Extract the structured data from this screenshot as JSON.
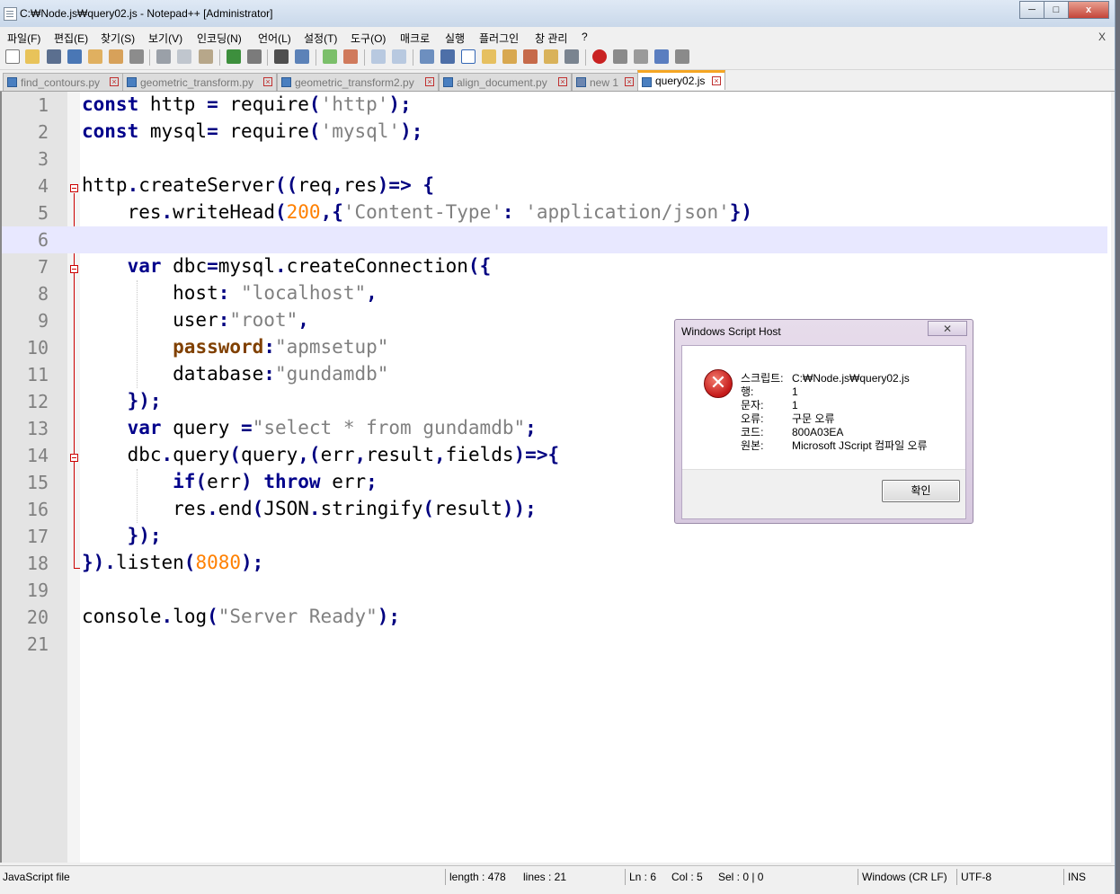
{
  "window": {
    "title": "C:₩Node.js₩query02.js - Notepad++ [Administrator]",
    "minimize": "─",
    "maximize": "□",
    "close": "x"
  },
  "menu": {
    "items": [
      "파일(F)",
      "편집(E)",
      "찾기(S)",
      "보기(V)",
      "인코딩(N)",
      "언어(L)",
      "설정(T)",
      "도구(O)",
      "매크로",
      "실행",
      "플러그인",
      "창 관리",
      "?"
    ],
    "close": "X"
  },
  "toolbar": {
    "icons": [
      "new-file-icon",
      "open-file-icon",
      "save-icon",
      "save-all-icon",
      "close-icon",
      "close-all-icon",
      "print-icon",
      "cut-icon",
      "copy-icon",
      "paste-icon",
      "undo-icon",
      "redo-icon",
      "find-icon",
      "replace-icon",
      "zoom-in-icon",
      "zoom-out-icon",
      "sync-v-icon",
      "sync-h-icon",
      "word-wrap-icon",
      "show-all-chars-icon",
      "indent-guide-icon",
      "udl-icon",
      "doc-map-icon",
      "function-list-icon",
      "folder-workspace-icon",
      "monitor-icon",
      "record-macro-icon",
      "stop-macro-icon",
      "play-macro-icon",
      "run-macro-multiple-icon",
      "save-macro-icon"
    ]
  },
  "tabs": [
    {
      "label": "find_contours.py",
      "active": false
    },
    {
      "label": "geometric_transform.py",
      "active": false
    },
    {
      "label": "geometric_transform2.py",
      "active": false
    },
    {
      "label": "align_document.py",
      "active": false
    },
    {
      "label": "new 1",
      "active": false
    },
    {
      "label": "query02.js",
      "active": true
    }
  ],
  "editor": {
    "current_line": 6,
    "lines": [
      {
        "n": "1",
        "text": "const http = require('http');"
      },
      {
        "n": "2",
        "text": "const mysql= require('mysql');"
      },
      {
        "n": "3",
        "text": ""
      },
      {
        "n": "4",
        "text": "http.createServer((req,res)=> {"
      },
      {
        "n": "5",
        "text": "    res.writeHead(200,{'Content-Type': 'application/json'})"
      },
      {
        "n": "6",
        "text": ""
      },
      {
        "n": "7",
        "text": "    var dbc=mysql.createConnection({"
      },
      {
        "n": "8",
        "text": "        host: \"localhost\","
      },
      {
        "n": "9",
        "text": "        user:\"root\","
      },
      {
        "n": "10",
        "text": "        password:\"apmsetup\""
      },
      {
        "n": "11",
        "text": "        database:\"gundamdb\""
      },
      {
        "n": "12",
        "text": "    });"
      },
      {
        "n": "13",
        "text": "    var query =\"select * from gundamdb\";"
      },
      {
        "n": "14",
        "text": "    dbc.query(query,(err,result,fields)=>{"
      },
      {
        "n": "15",
        "text": "        if(err) throw err;"
      },
      {
        "n": "16",
        "text": "        res.end(JSON.stringify(result));"
      },
      {
        "n": "17",
        "text": "    });"
      },
      {
        "n": "18",
        "text": "}).listen(8080);"
      },
      {
        "n": "19",
        "text": ""
      },
      {
        "n": "20",
        "text": "console.log(\"Server Ready\");"
      },
      {
        "n": "21",
        "text": ""
      }
    ]
  },
  "status": {
    "file_type": "JavaScript file",
    "length": "length : 478",
    "lines": "lines : 21",
    "ln": "Ln : 6",
    "col": "Col : 5",
    "sel": "Sel : 0 | 0",
    "eol": "Windows (CR LF)",
    "encoding": "UTF-8",
    "mode": "INS"
  },
  "dialog": {
    "title": "Windows Script Host",
    "close": "✕",
    "icon": "error-icon",
    "rows": [
      {
        "key": "스크립트:",
        "value": "C:₩Node.js₩query02.js"
      },
      {
        "key": "행:",
        "value": "1"
      },
      {
        "key": "문자:",
        "value": "1"
      },
      {
        "key": "오류:",
        "value": "구문 오류"
      },
      {
        "key": "코드:",
        "value": "800A03EA"
      },
      {
        "key": "원본:",
        "value": "Microsoft JScript 컴파일 오류"
      }
    ],
    "ok_label": "확인"
  }
}
